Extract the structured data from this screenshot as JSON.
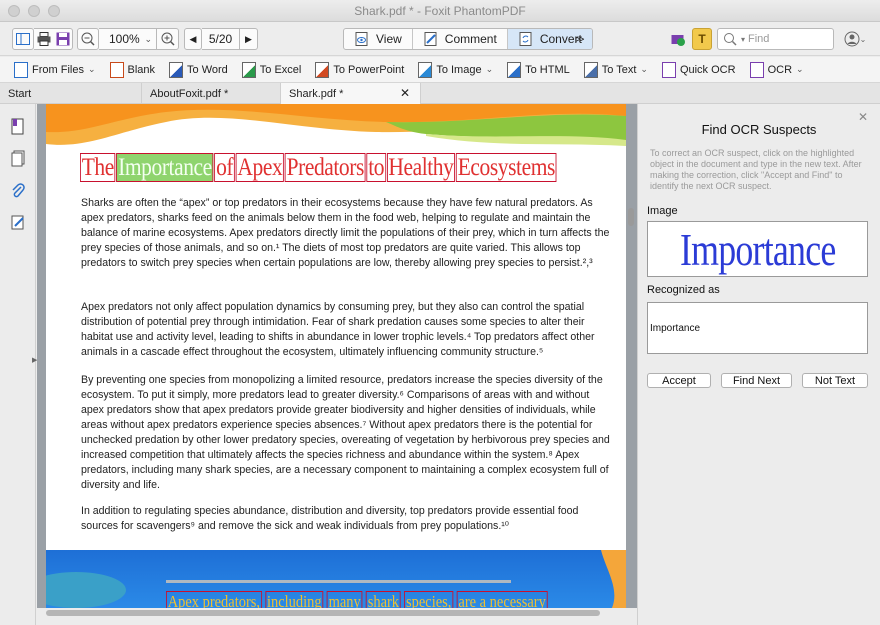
{
  "window": {
    "title": "Shark.pdf * - Foxit PhantomPDF"
  },
  "toolbar": {
    "zoom": "100%",
    "page_indicator": "5/20",
    "view_label": "View",
    "comment_label": "Comment",
    "convert_label": "Convert",
    "search_placeholder": "Find"
  },
  "convert_bar": {
    "items": [
      {
        "label": "From Files",
        "has_menu": true
      },
      {
        "label": "Blank",
        "has_menu": false
      },
      {
        "label": "To Word",
        "has_menu": false
      },
      {
        "label": "To Excel",
        "has_menu": false
      },
      {
        "label": "To PowerPoint",
        "has_menu": false
      },
      {
        "label": "To Image",
        "has_menu": true
      },
      {
        "label": "To HTML",
        "has_menu": false
      },
      {
        "label": "To Text",
        "has_menu": true
      },
      {
        "label": "Quick OCR",
        "has_menu": false
      },
      {
        "label": "OCR",
        "has_menu": true
      }
    ]
  },
  "tabs": [
    {
      "label": "Start"
    },
    {
      "label": "AboutFoxit.pdf *"
    },
    {
      "label": "Shark.pdf *",
      "active": true,
      "close": "✕"
    }
  ],
  "document": {
    "heading_words": [
      "The",
      "Importance",
      "of",
      "Apex",
      "Predators",
      "to",
      "Healthy",
      "Ecosystems"
    ],
    "paragraphs": [
      "Sharks are often the “apex” or top predators in their ecosystems because they have few natural predators. As apex predators, sharks feed on the animals below them in the food web, helping to regulate and maintain the balance of marine ecosystems. Apex predators directly limit the populations of their prey, which in turn affects the prey species of those animals, and so on.¹ The diets of most top predators are quite varied. This allows top predators to switch prey species when certain populations are low, thereby allowing prey species to persist.²,³",
      "Apex predators not only affect population dynamics by consuming prey, but they also can control the spatial distribution of potential prey through intimidation. Fear of shark predation causes some species to alter their habitat use and activity level, leading to shifts in abundance in lower trophic levels.⁴ Top predators affect other animals in a cascade effect throughout the ecosystem, ultimately influencing community structure.⁵",
      "By preventing one species from monopolizing a limited resource, predators increase the species diversity of the ecosystem. To put it simply, more predators lead to greater diversity.⁶ Comparisons of areas with and without apex predators show that apex predators provide greater biodiversity and higher densities of individuals, while areas without apex predators experience species absences.⁷ Without apex predators there is the potential for unchecked predation by other lower predatory species, overeating of vegetation by herbivorous prey species and increased competition that ultimately affects the species richness and abundance within the system.⁸ Apex predators, including many shark species, are a necessary component to maintaining a complex ecosystem full of diversity and life.",
      "In addition to regulating species abundance, distribution and diversity, top predators provide essential food sources for scavengers⁹ and remove the sick and weak individuals from prey populations.¹⁰"
    ],
    "bottom_heading_words": [
      "Apex predators,",
      "including",
      "many",
      "shark",
      "species,",
      "are a necessary"
    ]
  },
  "ocr_panel": {
    "title": "Find OCR Suspects",
    "help": "To correct an OCR suspect, click on the highlighted object in the document and type in the new text. After making the correction, click \"Accept and Find\" to identify the next OCR suspect.",
    "image_label": "Image",
    "image_word": "Importance",
    "recognized_label": "Recognized as",
    "recognized_value": "Importance",
    "accept_label": "Accept",
    "find_next_label": "Find Next",
    "not_text_label": "Not Text"
  },
  "colors": {
    "accent": "#d6e6f7",
    "heading_red": "#e03131",
    "suspect_highlight": "#8fd46e",
    "ocr_image_text": "#2b3bd6"
  }
}
